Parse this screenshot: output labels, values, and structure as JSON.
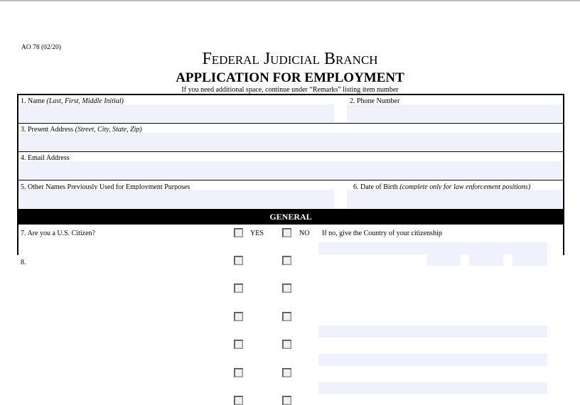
{
  "form_id": "AO 78 (02/20)",
  "title": "Federal Judicial Branch",
  "subtitle": "APPLICATION FOR EMPLOYMENT",
  "note": "If you need additional space, continue under “Remarks” listing item number",
  "fields": {
    "name": {
      "label": "1. Name ",
      "hint": "(Last, First, Middle Initial)",
      "value": ""
    },
    "phone": {
      "label": "2. Phone Number",
      "value": ""
    },
    "address": {
      "label": "3. Present Address ",
      "hint": "(Street, City, State, Zip)",
      "value": ""
    },
    "email": {
      "label": "4. Email Address",
      "value": ""
    },
    "other_names": {
      "label": "5. Other Names Previously Used for Employment Purposes",
      "value": ""
    },
    "dob": {
      "label": "6. Date of Birth ",
      "hint": "(complete only for law enforcement positions)",
      "value": ""
    }
  },
  "section_general": "GENERAL",
  "q7": {
    "label": "7. Are you a U.S. Citizen?",
    "yes": "YES",
    "no": "NO",
    "followup": "If no, give the Country of your citizenship",
    "yes_checked": false,
    "no_checked": false
  },
  "q8": {
    "label": "8."
  }
}
